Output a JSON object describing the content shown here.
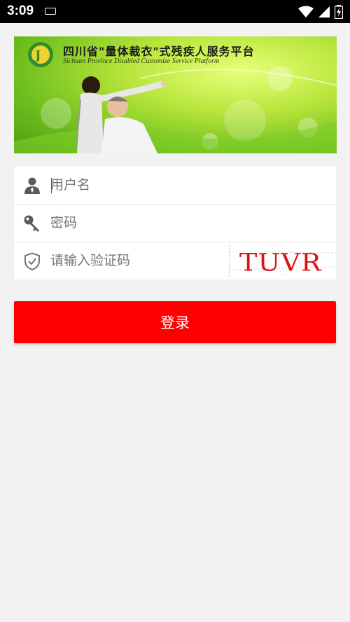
{
  "status_bar": {
    "time": "3:09"
  },
  "banner": {
    "title": "四川省\"量体裁衣\"式残疾人服务平台",
    "subtitle": "Sichuan Province Disabled Customize Service Platform"
  },
  "form": {
    "username_placeholder": "用户名",
    "password_placeholder": "密码",
    "captcha_placeholder": "请输入验证码",
    "captcha_code": "TUVR"
  },
  "login_label": "登录",
  "colors": {
    "accent": "#ff0000",
    "background": "#f2f2f2",
    "captcha_text": "#dd1111"
  }
}
